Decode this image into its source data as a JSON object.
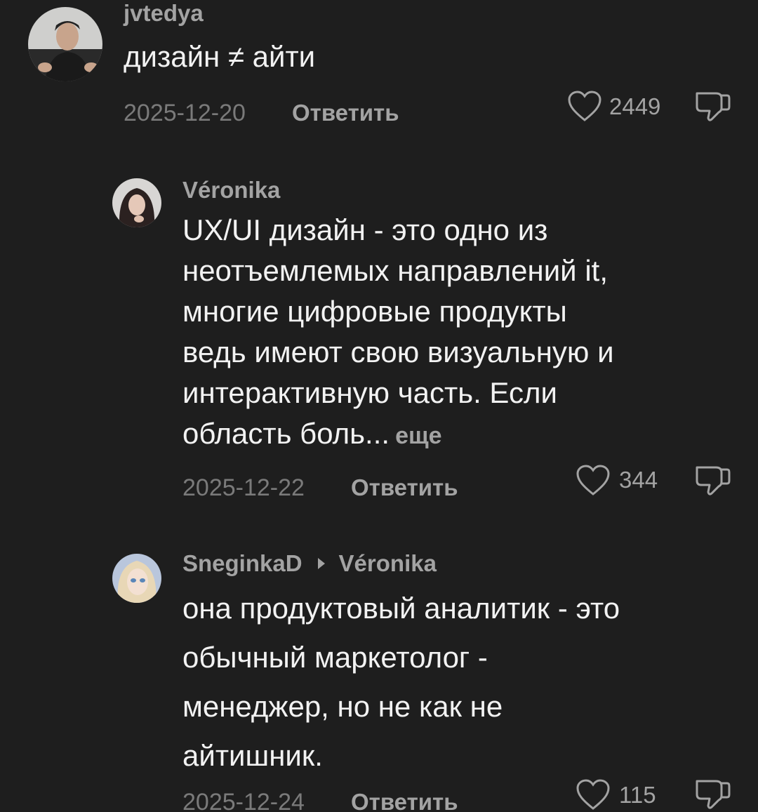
{
  "comments": [
    {
      "username": "jvtedya",
      "text_lines": [
        "дизайн ≠ айти"
      ],
      "date": "2025-12-20",
      "reply_label": "Ответить",
      "likes": "2449"
    },
    {
      "username": "Véronika",
      "text_lines": [
        "UX/UI дизайн - это одно из",
        "неотъемлемых направлений it,",
        "многие цифровые продукты",
        "ведь имеют свою визуальную и",
        "интерактивную часть. Если",
        "область боль..."
      ],
      "more_label": "еще",
      "date": "2025-12-22",
      "reply_label": "Ответить",
      "likes": "344"
    },
    {
      "username": "SneginkaD",
      "reply_to": "Véronika",
      "text_lines": [
        "она продуктовый аналитик - это",
        "обычный маркетолог -",
        "менеджер, но не как не",
        "айтишник."
      ],
      "date": "2025-12-24",
      "reply_label": "Ответить",
      "likes": "115"
    }
  ],
  "colors": {
    "background": "#1e1e1e",
    "text": "#f2f2f2",
    "secondary": "#a3a3a3",
    "date": "#7a7a7a"
  },
  "icons": [
    "heart-outline-icon",
    "thumbs-down-icon",
    "reply-arrow-icon"
  ]
}
